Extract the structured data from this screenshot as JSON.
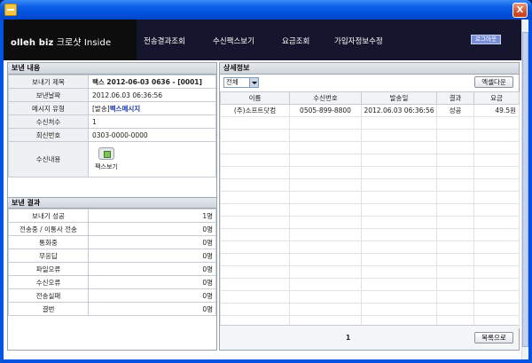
{
  "window": {
    "close_glyph": "X"
  },
  "header": {
    "brand_bold": "olleh biz",
    "brand_rest": " 크로샷 Inside",
    "nav": [
      "전송결과조회",
      "수신팩스보기",
      "요금조회",
      "가입자정보수정"
    ],
    "logout": "로그아웃"
  },
  "send_content": {
    "title": "보낸 내용",
    "rows": [
      {
        "label": "보내기 제목",
        "value": "팩스 2012-06-03 0636 - [0001]"
      },
      {
        "label": "보낸날짜",
        "value": "2012.06.03 06:36:56"
      },
      {
        "label": "메시지 유형",
        "prefix": "[발송]",
        "value": "팩스메시지"
      },
      {
        "label": "수신처수",
        "value": "1"
      },
      {
        "label": "회신번호",
        "value": "0303-0000-0000"
      },
      {
        "label": "수신내용",
        "value": "팩스보기"
      }
    ]
  },
  "send_result": {
    "title": "보낸 결과",
    "rows": [
      {
        "label": "보내기 성공",
        "value": "1명"
      },
      {
        "label": "전송중 / 이통사 전송",
        "value": "0명"
      },
      {
        "label": "통화중",
        "value": "0명"
      },
      {
        "label": "무응답",
        "value": "0명"
      },
      {
        "label": "파일오류",
        "value": "0명"
      },
      {
        "label": "수신오류",
        "value": "0명"
      },
      {
        "label": "전송실패",
        "value": "0명"
      },
      {
        "label": "결번",
        "value": "0명"
      }
    ]
  },
  "detail": {
    "title": "상세정보",
    "filter_value": "전체",
    "excel_button": "엑셀다운",
    "columns": [
      "이름",
      "수신번호",
      "발송일",
      "결과",
      "요금"
    ],
    "rows": [
      [
        "(주)소프트닷컴",
        "0505-899-8800",
        "2012.06.03 06:36:56",
        "성공",
        "49.5원"
      ]
    ],
    "page": "1",
    "list_button": "목록으로"
  }
}
